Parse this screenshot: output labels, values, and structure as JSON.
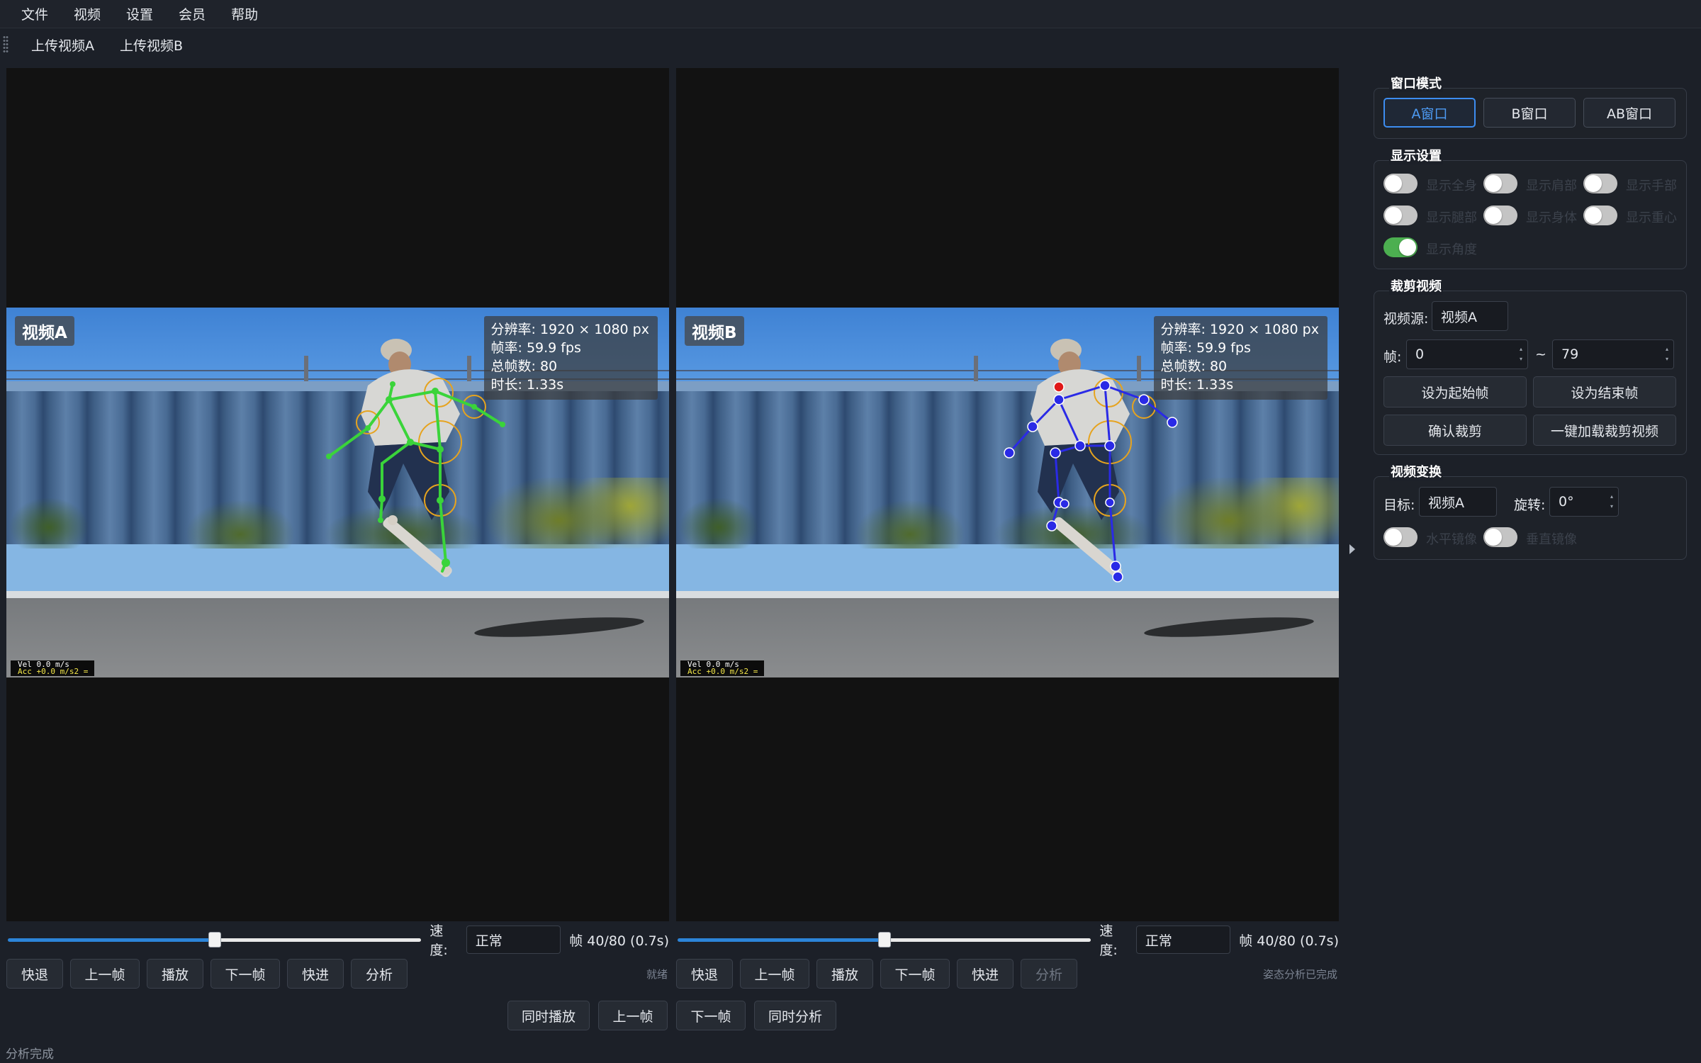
{
  "menu": [
    "文件",
    "视频",
    "设置",
    "会员",
    "帮助"
  ],
  "toolbar": {
    "upload_a": "上传视频A",
    "upload_b": "上传视频B"
  },
  "video_a": {
    "badge": "视频A",
    "info": [
      "分辨率: 1920 × 1080 px",
      "帧率: 59.9 fps",
      "总帧数: 80",
      "时长: 1.33s"
    ],
    "vel": "Vel 0.0 m/s",
    "acc": "Acc +0.0 m/s2 =",
    "skeleton_color": "#3ad43a",
    "speed_label": "速度:",
    "speed_value": "正常",
    "frame_info": "帧 40/80  (0.7s)",
    "progress": 0.5,
    "buttons": [
      "快退",
      "上一帧",
      "播放",
      "下一帧",
      "快进",
      "分析"
    ],
    "hint": "就绪"
  },
  "video_b": {
    "badge": "视频B",
    "info": [
      "分辨率: 1920 × 1080 px",
      "帧率: 59.9 fps",
      "总帧数: 80",
      "时长: 1.33s"
    ],
    "vel": "Vel 0.0 m/s",
    "acc": "Acc +0.0 m/s2 =",
    "skeleton_color": "#2a2ae6",
    "speed_label": "速度:",
    "speed_value": "正常",
    "frame_info": "帧 40/80  (0.7s)",
    "progress": 0.5,
    "buttons": [
      "快退",
      "上一帧",
      "播放",
      "下一帧",
      "快进",
      "分析"
    ],
    "hint": "姿态分析已完成"
  },
  "sync_buttons": [
    "同时播放",
    "上一帧",
    "下一帧",
    "同时分析"
  ],
  "status": "分析完成",
  "panel": {
    "window_mode": {
      "title": "窗口模式",
      "options": [
        "A窗口",
        "B窗口",
        "AB窗口"
      ],
      "selected": "A窗口"
    },
    "display": {
      "title": "显示设置",
      "toggles": [
        {
          "label": "显示全身",
          "on": false
        },
        {
          "label": "显示肩部",
          "on": false
        },
        {
          "label": "显示手部",
          "on": false
        },
        {
          "label": "显示腿部",
          "on": false
        },
        {
          "label": "显示身体",
          "on": false
        },
        {
          "label": "显示重心",
          "on": false
        },
        {
          "label": "显示角度",
          "on": true
        }
      ]
    },
    "crop": {
      "title": "裁剪视频",
      "source_label": "视频源:",
      "source_value": "视频A",
      "frame_label": "帧:",
      "start_frame": "0",
      "tilde": "~",
      "end_frame": "79",
      "set_start": "设为起始帧",
      "set_end": "设为结束帧",
      "confirm": "确认裁剪",
      "load": "一键加载裁剪视频"
    },
    "transform": {
      "title": "视频变换",
      "target_label": "目标:",
      "target_value": "视频A",
      "rotate_label": "旋转:",
      "rotate_value": "0°",
      "flip_h": "水平镜像",
      "flip_v": "垂直镜像"
    }
  }
}
